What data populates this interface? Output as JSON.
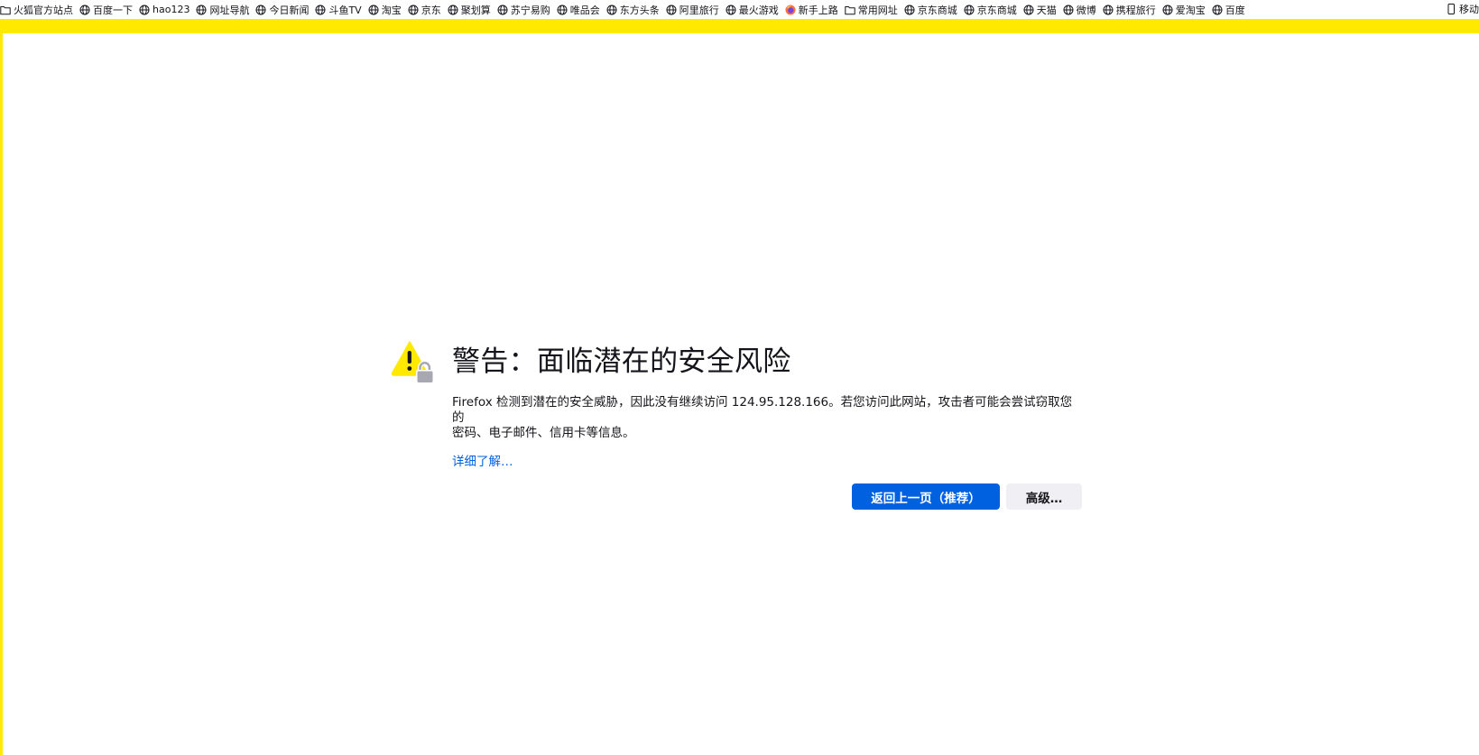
{
  "bookmarks": [
    {
      "label": "火狐官方站点",
      "icon": "folder-icon"
    },
    {
      "label": "百度一下",
      "icon": "globe-icon"
    },
    {
      "label": "hao123",
      "icon": "globe-icon"
    },
    {
      "label": "网址导航",
      "icon": "globe-icon"
    },
    {
      "label": "今日新闻",
      "icon": "globe-icon"
    },
    {
      "label": "斗鱼TV",
      "icon": "globe-icon"
    },
    {
      "label": "淘宝",
      "icon": "globe-icon"
    },
    {
      "label": "京东",
      "icon": "globe-icon"
    },
    {
      "label": "聚划算",
      "icon": "globe-icon"
    },
    {
      "label": "苏宁易购",
      "icon": "globe-icon"
    },
    {
      "label": "唯品会",
      "icon": "globe-icon"
    },
    {
      "label": "东方头条",
      "icon": "globe-icon"
    },
    {
      "label": "阿里旅行",
      "icon": "globe-icon"
    },
    {
      "label": "最火游戏",
      "icon": "globe-icon"
    },
    {
      "label": "新手上路",
      "icon": "firefox-icon"
    },
    {
      "label": "常用网址",
      "icon": "folder-icon"
    },
    {
      "label": "京东商城",
      "icon": "globe-icon"
    },
    {
      "label": "京东商城",
      "icon": "globe-icon"
    },
    {
      "label": "天猫",
      "icon": "globe-icon"
    },
    {
      "label": "微博",
      "icon": "globe-icon"
    },
    {
      "label": "携程旅行",
      "icon": "globe-icon"
    },
    {
      "label": "爱淘宝",
      "icon": "globe-icon"
    },
    {
      "label": "百度",
      "icon": "globe-icon"
    }
  ],
  "mobile_bookmarks_label": "移动",
  "warning": {
    "title": "警告：面临潜在的安全风险",
    "description_line1": "Firefox 检测到潜在的安全威胁，因此没有继续访问 124.95.128.166。若您访问此网站，攻击者可能会尝试窃取您的",
    "description_line2": "密码、电子邮件、信用卡等信息。",
    "learn_more": "详细了解…",
    "go_back_button": "返回上一页（推荐）",
    "advanced_button": "高级…",
    "accent_color": "#ffe900",
    "primary_button_color": "#0061e0",
    "link_color": "#0061e0"
  }
}
